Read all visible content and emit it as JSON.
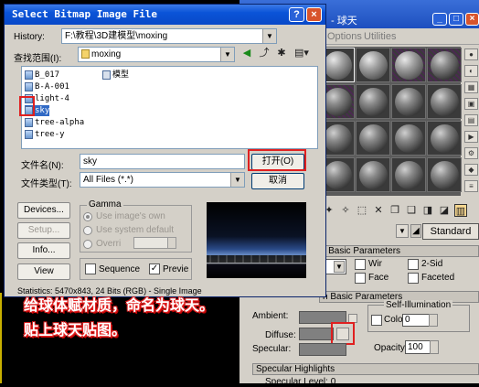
{
  "background_editor": {
    "title": "- 球天",
    "menu": [
      "Options",
      "Utilities"
    ],
    "material_type": "Standard",
    "rollouts": {
      "shader_basic": "r Basic Parameters",
      "basic": "n Basic Parameters",
      "specular": "Specular Highlights"
    },
    "shader_options": {
      "wire": "Wir",
      "two_sided": "2-Sid",
      "face": "Face",
      "faceted": "Faceted"
    },
    "self_illumination": {
      "label": "Self-Illumination",
      "color_label": "Colo",
      "color_value": "0"
    },
    "opacity": {
      "label": "Opacity:",
      "value": "100"
    },
    "color_labels": {
      "ambient": "Ambient:",
      "diffuse": "Diffuse:",
      "specular": "Specular:"
    },
    "specular_level_label": "Specular Level: 0"
  },
  "dialog": {
    "title": "Select Bitmap Image File",
    "history_label": "History:",
    "history_value": "F:\\教程\\3D建模型\\moxing",
    "lookin_label": "查找范围(I):",
    "lookin_value": "moxing",
    "files": [
      {
        "name": "B_017",
        "type": "img"
      },
      {
        "name": "B-A-001",
        "type": "img"
      },
      {
        "name": "light-4",
        "type": "img"
      },
      {
        "name": "sky",
        "type": "img"
      },
      {
        "name": "tree-alpha",
        "type": "img"
      },
      {
        "name": "tree-y",
        "type": "img"
      }
    ],
    "folder_item": "模型",
    "filename_label": "文件名(N):",
    "filename_value": "sky",
    "filetype_label": "文件类型(T):",
    "filetype_value": "All Files (*.*)",
    "open_button": "打开(O)",
    "cancel_button": "取消",
    "devices_button": "Devices...",
    "setup_button": "Setup...",
    "info_button": "Info...",
    "view_button": "View",
    "gamma": {
      "title": "Gamma",
      "use_own": "Use image's own",
      "use_system": "Use system default",
      "override": "Overri"
    },
    "sequence_label": "Sequence",
    "preview_label": "Previe",
    "statistics": "Statistics: 5470x843, 24 Bits (RGB) - Single Image"
  },
  "captions": {
    "line1": "给球体赋材质，命名为球天。",
    "line2": "贴上球天贴图。"
  }
}
